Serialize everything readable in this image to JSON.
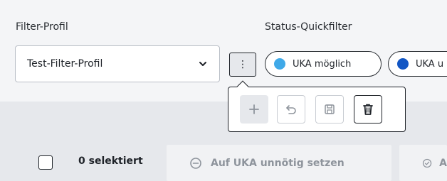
{
  "filter_profile": {
    "label": "Filter-Profil",
    "selected": "Test-Filter-Profil",
    "chevron_icon": "chevron-down-icon"
  },
  "status_quickfilter": {
    "label": "Status-Quickfilter",
    "chips": [
      {
        "label": "UKA möglich",
        "color": "#3fa9e8"
      },
      {
        "label": "UKA u",
        "color": "#1256c4"
      }
    ]
  },
  "more_button": {
    "icon": "vertical-dots-icon",
    "glyph": "⋮"
  },
  "popover": {
    "buttons": [
      {
        "icon": "plus-icon",
        "state": "disabled"
      },
      {
        "icon": "undo-icon",
        "state": "disabled"
      },
      {
        "icon": "save-icon",
        "state": "disabled"
      },
      {
        "icon": "trash-icon",
        "state": "enabled"
      }
    ]
  },
  "selection": {
    "count_label": "0 selektiert"
  },
  "actions": {
    "unnoetig_label": "Auf UKA unnötig setzen",
    "next_label": "A"
  },
  "colors": {
    "top_panel": "#f4f5f7",
    "bottom_panel": "#e6e8ec",
    "disabled_text": "#8e949c",
    "border_dark": "#1f2329"
  }
}
